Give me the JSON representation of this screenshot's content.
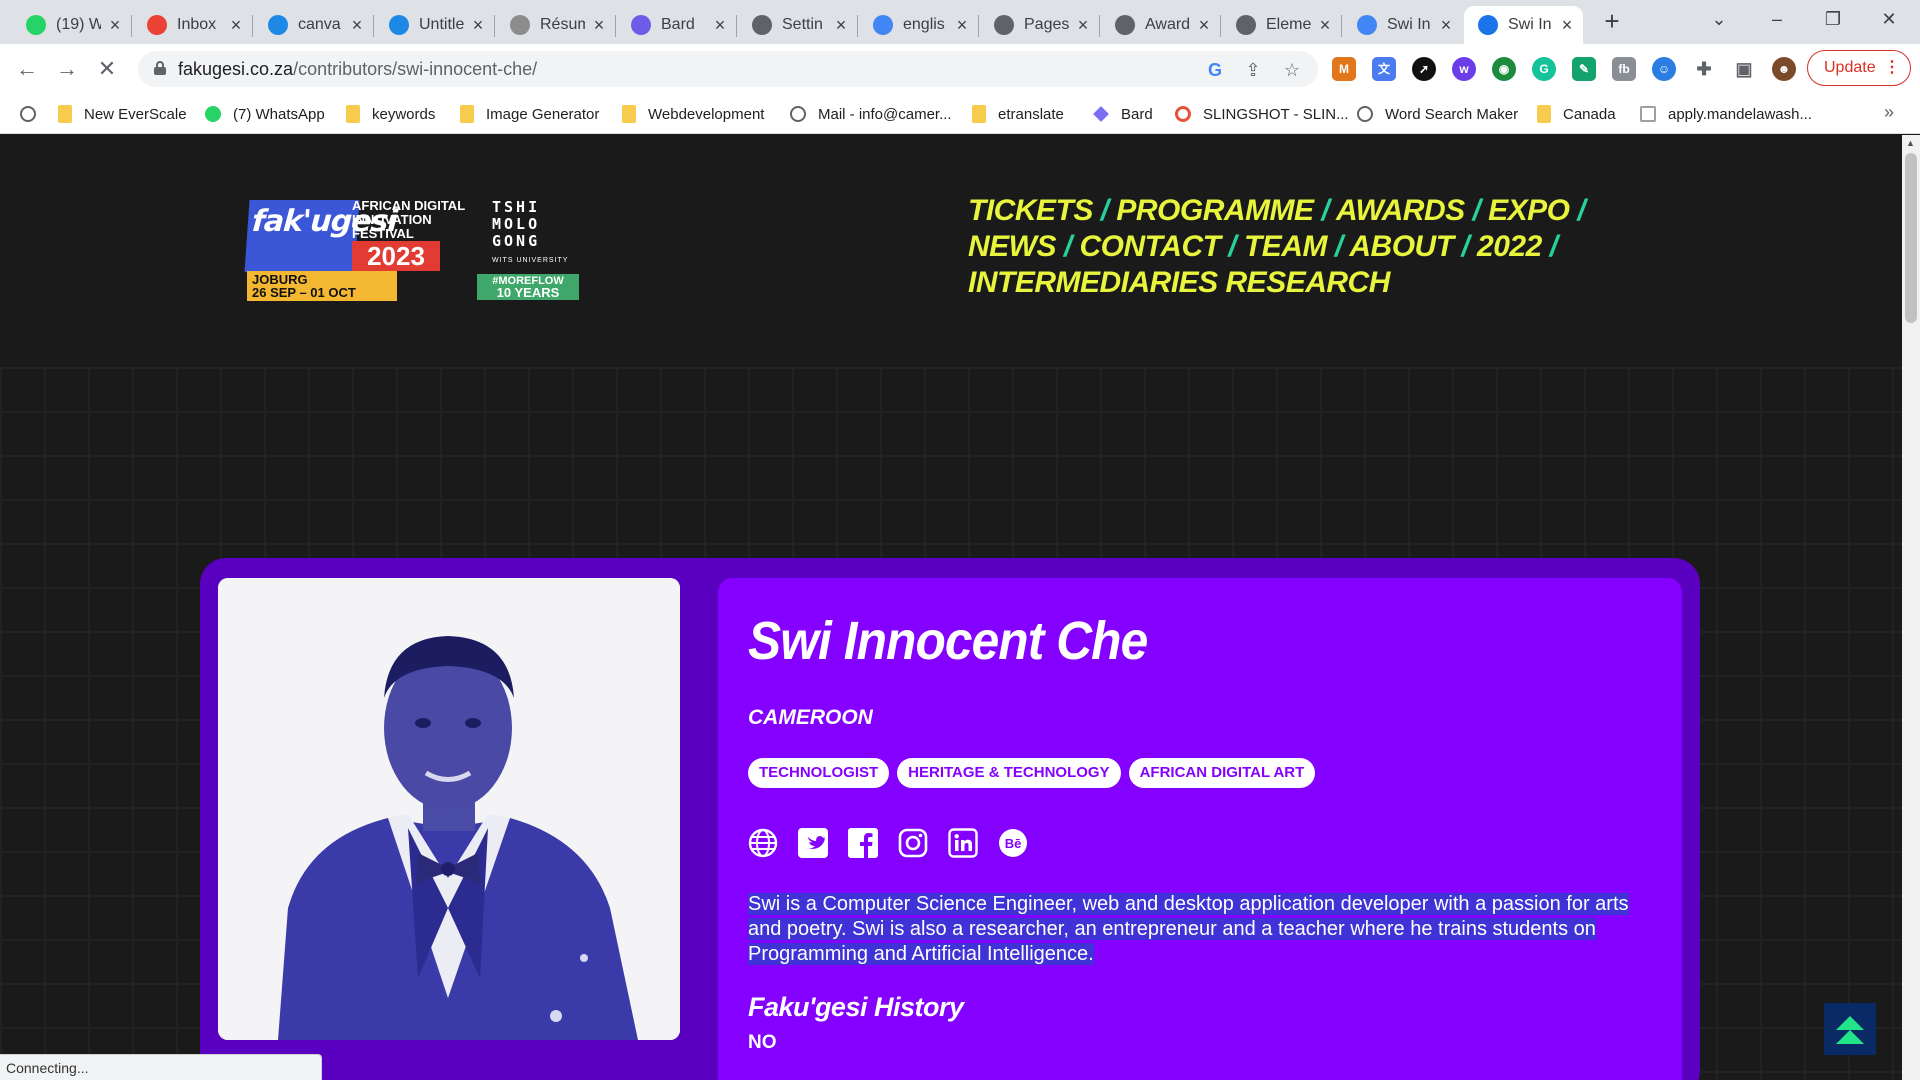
{
  "tabs": [
    {
      "title": "(19) W",
      "icon": "whatsapp-icon",
      "color": "#25d366"
    },
    {
      "title": "Inbox",
      "icon": "gmail-icon",
      "color": "#ea4335"
    },
    {
      "title": "canva",
      "icon": "canva-icon",
      "color": "#1e88e5"
    },
    {
      "title": "Untitle",
      "icon": "canva-icon",
      "color": "#1e88e5"
    },
    {
      "title": "Résum",
      "icon": "document-icon",
      "color": "#8c8c8c"
    },
    {
      "title": "Bard",
      "icon": "bard-icon",
      "color": "#6c5ce7"
    },
    {
      "title": "Settin",
      "icon": "globe-icon",
      "color": "#5f6368"
    },
    {
      "title": "englis",
      "icon": "google-icon",
      "color": "#4285f4"
    },
    {
      "title": "Pages",
      "icon": "globe-icon",
      "color": "#5f6368"
    },
    {
      "title": "Award",
      "icon": "globe-icon",
      "color": "#5f6368"
    },
    {
      "title": "Eleme",
      "icon": "globe-icon",
      "color": "#5f6368"
    },
    {
      "title": "Swi In",
      "icon": "google-icon",
      "color": "#4285f4"
    },
    {
      "title": "Swi In",
      "icon": "loading-icon",
      "color": "#1a73e8"
    }
  ],
  "address": {
    "domain": "fakugesi.co.za",
    "path": "/contributors/swi-innocent-che/"
  },
  "toolbar": {
    "update_label": "Update"
  },
  "bookmarks": [
    {
      "label": "",
      "icon": "globe-icon"
    },
    {
      "label": "New EverScale",
      "icon": "folder-icon"
    },
    {
      "label": "(7) WhatsApp",
      "icon": "whatsapp-icon"
    },
    {
      "label": "keywords",
      "icon": "folder-icon"
    },
    {
      "label": "Image Generator",
      "icon": "folder-icon"
    },
    {
      "label": "Webdevelopment",
      "icon": "folder-icon"
    },
    {
      "label": "Mail - info@camer...",
      "icon": "globe-icon"
    },
    {
      "label": "etranslate",
      "icon": "folder-icon"
    },
    {
      "label": "Bard",
      "icon": "bard-icon"
    },
    {
      "label": "SLINGSHOT - SLIN...",
      "icon": "slingshot-icon"
    },
    {
      "label": "Word Search Maker",
      "icon": "globe-icon"
    },
    {
      "label": "Canada",
      "icon": "folder-icon"
    },
    {
      "label": "apply.mandelawash...",
      "icon": "document-icon"
    }
  ],
  "site": {
    "logo": {
      "brand": "fak'ugesi",
      "tagline": "AFRICAN DIGITAL INNOVATION FESTIVAL",
      "year": "2023",
      "city": "JOBURG",
      "dates": "26 SEP – 01 OCT",
      "partner": "TSHI MOLO GONG",
      "partner_sub": "WITS UNIVERSITY",
      "hashtag": "#MOREFLOW",
      "anniversary": "10 YEARS"
    },
    "nav": [
      "TICKETS",
      "PROGRAMME",
      "AWARDS",
      "EXPO",
      "NEWS",
      "CONTACT",
      "TEAM",
      "ABOUT",
      "2022",
      "INTERMEDIARIES RESEARCH"
    ],
    "nav_separator": " / ",
    "colors": {
      "nav": "#e8f53c",
      "separator": "#25d39a",
      "card_outer": "#5a00c0",
      "card_inner": "#8400ff"
    }
  },
  "profile": {
    "name": "Swi Innocent Che",
    "country": "CAMEROON",
    "tags": [
      "TECHNOLOGIST",
      "HERITAGE & TECHNOLOGY",
      "AFRICAN DIGITAL ART"
    ],
    "socials": [
      "website-icon",
      "twitter-icon",
      "facebook-icon",
      "instagram-icon",
      "linkedin-icon",
      "behance-icon"
    ],
    "bio": "Swi is a Computer Science Engineer, web and desktop application developer with a passion for arts and poetry. Swi is also a researcher, an entrepreneur and a teacher where he trains students on Programming and Artificial Intelligence.",
    "history_label": "Faku'gesi History",
    "history_value": "NO"
  },
  "status_text": "Connecting..."
}
